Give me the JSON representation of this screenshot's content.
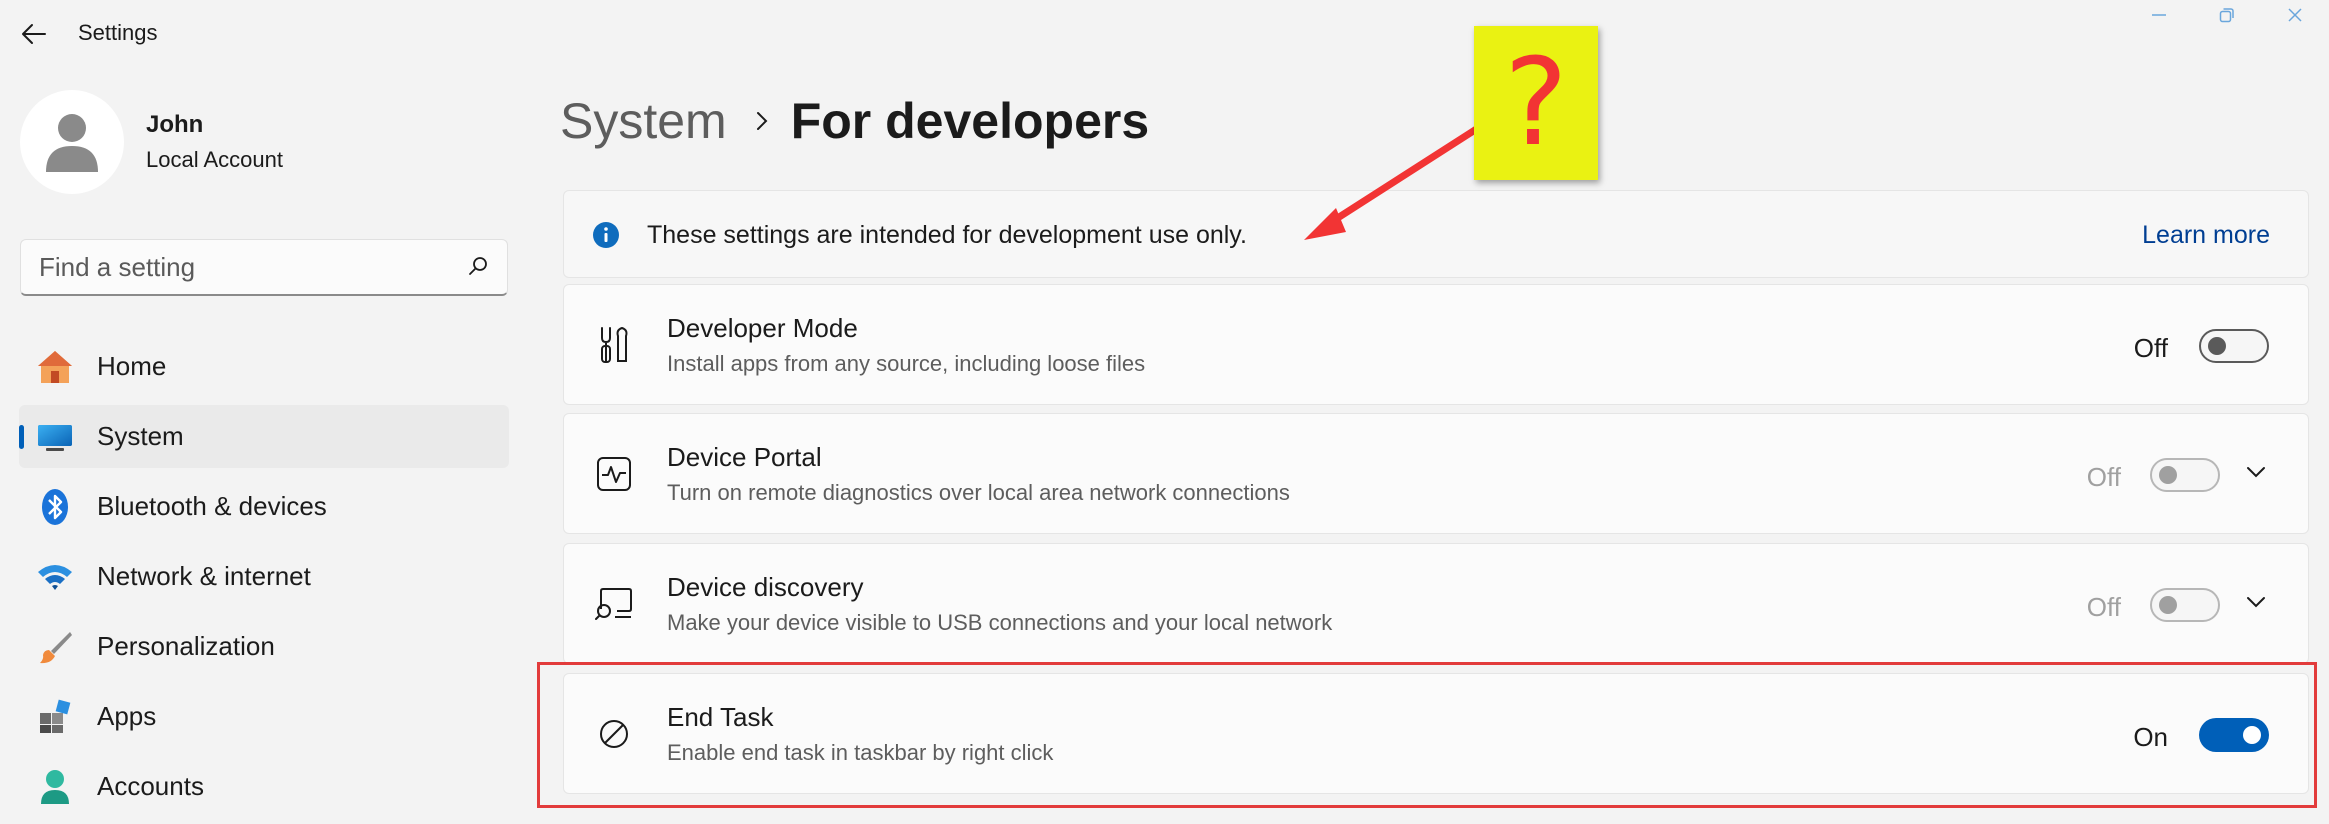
{
  "window": {
    "title": "Settings"
  },
  "profile": {
    "name": "John",
    "account_type": "Local Account"
  },
  "search": {
    "placeholder": "Find a setting"
  },
  "nav": {
    "items": [
      {
        "label": "Home",
        "icon": "home-icon"
      },
      {
        "label": "System",
        "icon": "system-icon",
        "active": true
      },
      {
        "label": "Bluetooth & devices",
        "icon": "bluetooth-icon"
      },
      {
        "label": "Network & internet",
        "icon": "wifi-icon"
      },
      {
        "label": "Personalization",
        "icon": "brush-icon"
      },
      {
        "label": "Apps",
        "icon": "apps-icon"
      },
      {
        "label": "Accounts",
        "icon": "accounts-icon"
      }
    ]
  },
  "breadcrumb": {
    "parent": "System",
    "current": "For developers"
  },
  "info_banner": {
    "text": "These settings are intended for development use only.",
    "link": "Learn more"
  },
  "settings": [
    {
      "title": "Developer Mode",
      "description": "Install apps from any source, including loose files",
      "state": "Off",
      "enabled": true,
      "expandable": false,
      "icon": "tools-icon"
    },
    {
      "title": "Device Portal",
      "description": "Turn on remote diagnostics over local area network connections",
      "state": "Off",
      "enabled": false,
      "expandable": true,
      "icon": "pulse-icon"
    },
    {
      "title": "Device discovery",
      "description": "Make your device visible to USB connections and your local network",
      "state": "Off",
      "enabled": false,
      "expandable": true,
      "icon": "device-search-icon"
    },
    {
      "title": "End Task",
      "description": "Enable end task in taskbar by right click",
      "state": "On",
      "enabled": true,
      "expandable": false,
      "icon": "prohibited-icon"
    }
  ],
  "annotation": {
    "note_text": "?",
    "colors": {
      "note": "#eaf212",
      "arrow": "#f23434",
      "highlight": "#e23b3b"
    }
  },
  "colors": {
    "accent": "#005fb8",
    "link": "#003e92"
  }
}
